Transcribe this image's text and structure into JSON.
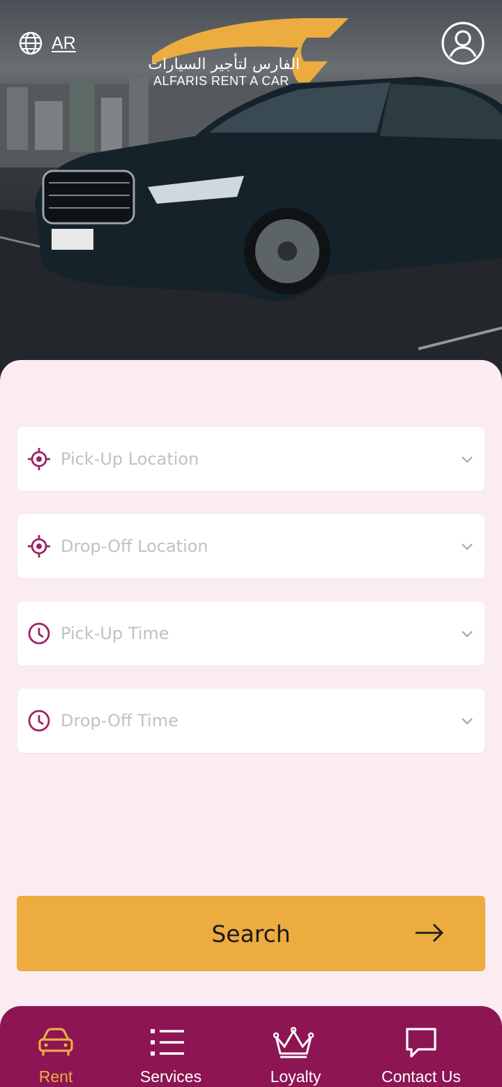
{
  "header": {
    "language_label": "AR",
    "brand_arabic": "الفارس لتأجير السيارات",
    "brand_english": "ALFARIS RENT A CAR"
  },
  "form": {
    "fields": [
      {
        "label": "Pick-Up Location",
        "icon": "target-icon"
      },
      {
        "label": "Drop-Off Location",
        "icon": "target-icon"
      },
      {
        "label": "Pick-Up Time",
        "icon": "clock-icon"
      },
      {
        "label": "Drop-Off Time",
        "icon": "clock-icon"
      }
    ],
    "search_label": "Search"
  },
  "nav": {
    "items": [
      {
        "label": "Rent",
        "icon": "car-icon",
        "active": true
      },
      {
        "label": "Services",
        "icon": "list-icon",
        "active": false
      },
      {
        "label": "Loyalty",
        "icon": "crown-icon",
        "active": false
      },
      {
        "label": "Contact Us",
        "icon": "chat-bubble-icon",
        "active": false
      }
    ]
  },
  "colors": {
    "accent": "#ecac3f",
    "brand": "#8d1553",
    "background": "#fbecf2",
    "placeholder": "#c3c0c4"
  }
}
